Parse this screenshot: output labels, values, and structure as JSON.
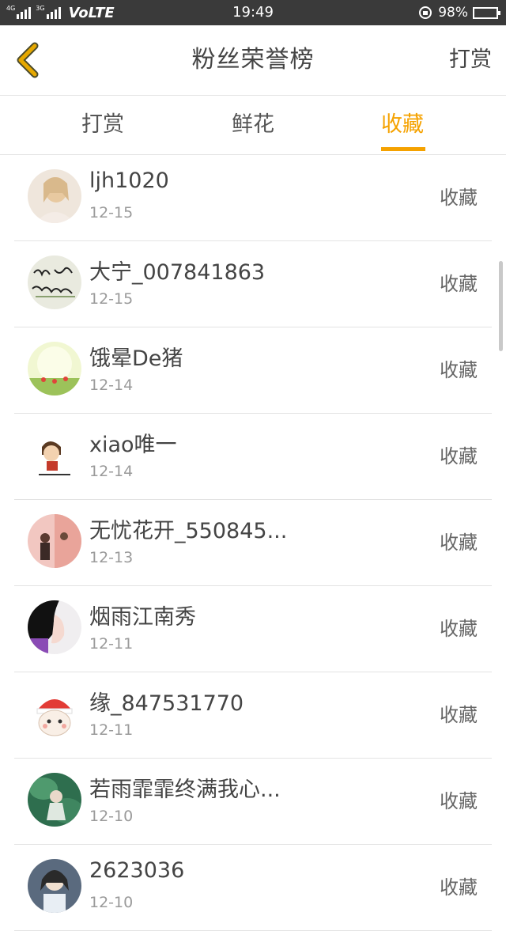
{
  "status_bar": {
    "signal_tag_1": "4G",
    "signal_tag_2": "3G",
    "network": "VoLTE",
    "time": "19:49",
    "battery": "98%"
  },
  "header": {
    "title": "粉丝荣誉榜",
    "action_label": "打赏"
  },
  "tabs": [
    {
      "label": "打赏",
      "active": false
    },
    {
      "label": "鲜花",
      "active": false
    },
    {
      "label": "收藏",
      "active": true
    }
  ],
  "list": [
    {
      "name": "ljh1020",
      "date": "12-15",
      "type": "收藏"
    },
    {
      "name": "大宁_007841863",
      "date": "12-15",
      "type": "收藏"
    },
    {
      "name": "饿晕De猪",
      "date": "12-14",
      "type": "收藏"
    },
    {
      "name": "xiao唯一",
      "date": "12-14",
      "type": "收藏"
    },
    {
      "name": "无忧花开_550845...",
      "date": "12-13",
      "type": "收藏"
    },
    {
      "name": "烟雨江南秀",
      "date": "12-11",
      "type": "收藏"
    },
    {
      "name": "缘_847531770",
      "date": "12-11",
      "type": "收藏"
    },
    {
      "name": "若雨霏霏终满我心...",
      "date": "12-10",
      "type": "收藏"
    },
    {
      "name": "2623036",
      "date": "12-10",
      "type": "收藏"
    }
  ],
  "colors": {
    "accent": "#f5a200",
    "back_arrow": "#e6a800",
    "status_bar_bg": "#3a3a3a"
  },
  "icons": [
    "chevron-left-icon",
    "signal-icon",
    "rotation-lock-icon",
    "battery-icon"
  ]
}
